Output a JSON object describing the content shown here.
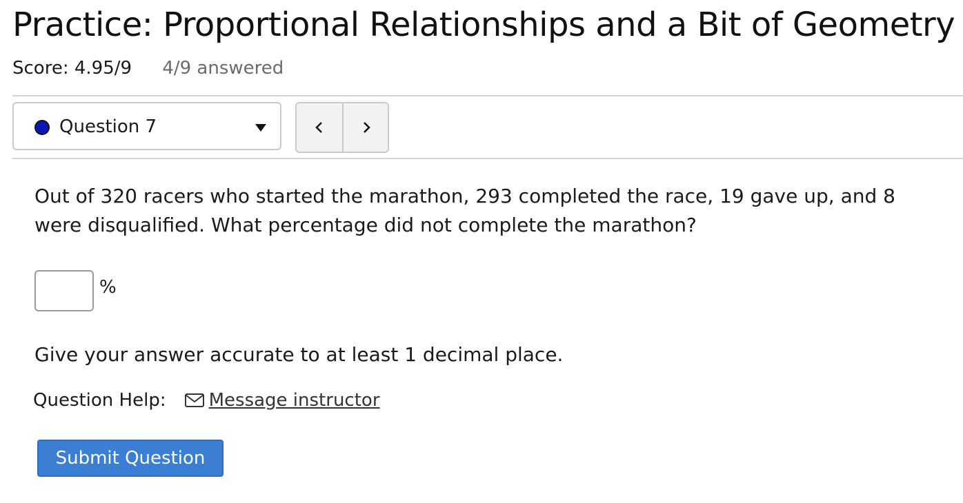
{
  "header": {
    "title": "Practice: Proportional Relationships and a Bit of Geometry",
    "score": "Score: 4.95/9",
    "answered": "4/9 answered"
  },
  "question_nav": {
    "current": "Question 7",
    "status_color": "#0a16b5",
    "prev_icon": "chevron-left-icon",
    "next_icon": "chevron-right-icon"
  },
  "question": {
    "text": "Out of 320 racers who started the marathon, 293 completed the race, 19 gave up, and 8 were disqualified. What percentage did not complete the marathon?",
    "answer_value": "",
    "unit": "%",
    "hint": "Give your answer accurate to at least 1 decimal place."
  },
  "help": {
    "label": "Question Help:",
    "message_icon": "envelope-icon",
    "message_link": "Message instructor"
  },
  "actions": {
    "submit_label": "Submit Question",
    "submit_color": "#3b7fd4"
  }
}
